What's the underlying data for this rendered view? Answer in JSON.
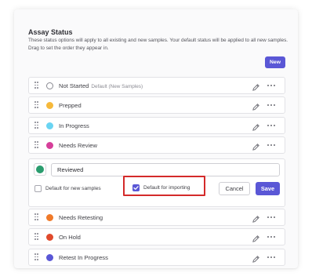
{
  "section": {
    "title": "Assay Status",
    "description": "These status options will apply to all existing and new samples. Your default status will be applied to all new samples. Drag to set the order they appear in."
  },
  "toolbar": {
    "new_label": "New"
  },
  "statuses_top": [
    {
      "label": "Not Started",
      "sublabel": "Default (New Samples)",
      "color": "outline",
      "icon": "empty-circle-icon"
    },
    {
      "label": "Prepped",
      "sublabel": "",
      "color": "#f6b93b",
      "icon": "status-dot"
    },
    {
      "label": "In Progress",
      "sublabel": "",
      "color": "#6ad4f2",
      "icon": "status-dot"
    },
    {
      "label": "Needs Review",
      "sublabel": "",
      "color": "#d63f9a",
      "icon": "status-dot"
    }
  ],
  "editor": {
    "name_value": "Reviewed",
    "swatch_color": "#2a9d6e",
    "default_new_label": "Default for new samples",
    "default_new_checked": false,
    "default_import_label": "Default for importing",
    "default_import_checked": true,
    "cancel_label": "Cancel",
    "save_label": "Save",
    "highlight_color": "#d42a2a"
  },
  "statuses_bottom": [
    {
      "label": "Needs Retesting",
      "sublabel": "",
      "color": "#f07a2a",
      "icon": "status-dot"
    },
    {
      "label": "On Hold",
      "sublabel": "",
      "color": "#e04a2c",
      "icon": "status-dot"
    },
    {
      "label": "Retest In Progress",
      "sublabel": "",
      "color": "#5a57d6",
      "icon": "status-dot"
    }
  ],
  "colors": {
    "accent": "#5a57d6"
  }
}
